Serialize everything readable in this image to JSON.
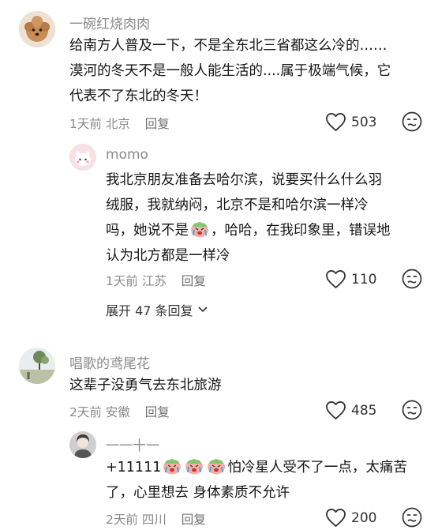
{
  "comments": [
    {
      "username": "一碗红烧肉肉",
      "lines": [
        "给南方人普及一下，不是全东北三省都这么冷的……",
        "漠河的冬天不是一般人能生活的....属于极端气候，它",
        "代表不了东北的冬天！"
      ],
      "time": "1天前",
      "location": "北京",
      "reply_label": "回复",
      "likes": "503",
      "replies": [
        {
          "username": "momo",
          "line1": "我北京朋友准备去哈尔滨，说要买什么什么羽",
          "line2": "绒服，我就纳闷，北京不是和哈尔滨一样冷",
          "line3_a": "吗，她说不是",
          "line3_b": "，哈哈，在我印象里，错误地",
          "line4": "认为北方都是一样冷",
          "time": "1天前",
          "location": "江苏",
          "reply_label": "回复",
          "likes": "110"
        }
      ],
      "expand_label": "展开 47 条回复"
    },
    {
      "username": "唱歌的鸢尾花",
      "lines": [
        "这辈子没勇气去东北旅游"
      ],
      "time": "2天前",
      "location": "安徽",
      "reply_label": "回复",
      "likes": "485",
      "replies": [
        {
          "username": "一一十一",
          "line1_a": "+11111",
          "line1_b": "怕冷星人受不了一点，太痛苦",
          "line2": "了，心里想去 身体素质不允许",
          "time": "2天前",
          "location": "四川",
          "reply_label": "回复",
          "likes": "200"
        }
      ]
    }
  ]
}
